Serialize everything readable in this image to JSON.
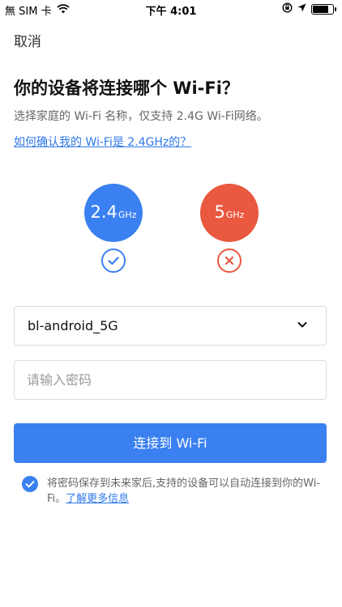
{
  "status_bar": {
    "carrier": "無 SIM 卡",
    "time": "下午 4:01",
    "battery_level": 0.72
  },
  "nav": {
    "cancel_label": "取消"
  },
  "header": {
    "title": "你的设备将连接哪个 Wi-Fi？",
    "subtitle": "选择家庭的 Wi-Fi 名称，仅支持 2.4G Wi-Fi网络。",
    "help_link": "如何确认我的 Wi-Fi是 2.4GHz的？"
  },
  "bands": {
    "supported": {
      "number": "2.4",
      "unit": "GHz",
      "color": "#3a80f0",
      "status_icon": "check-circle-icon"
    },
    "unsupported": {
      "number": "5",
      "unit": "GHz",
      "color": "#e9583f",
      "status_icon": "x-circle-icon"
    }
  },
  "form": {
    "wifi_name": "bl-android_5G",
    "password_placeholder": "请输入密码",
    "connect_label": "连接到 Wi-Fi"
  },
  "agreement": {
    "checked": true,
    "text": "将密码保存到未来家后,支持的设备可以自动连接到你的Wi-Fi。",
    "more_link": "了解更多信息"
  }
}
